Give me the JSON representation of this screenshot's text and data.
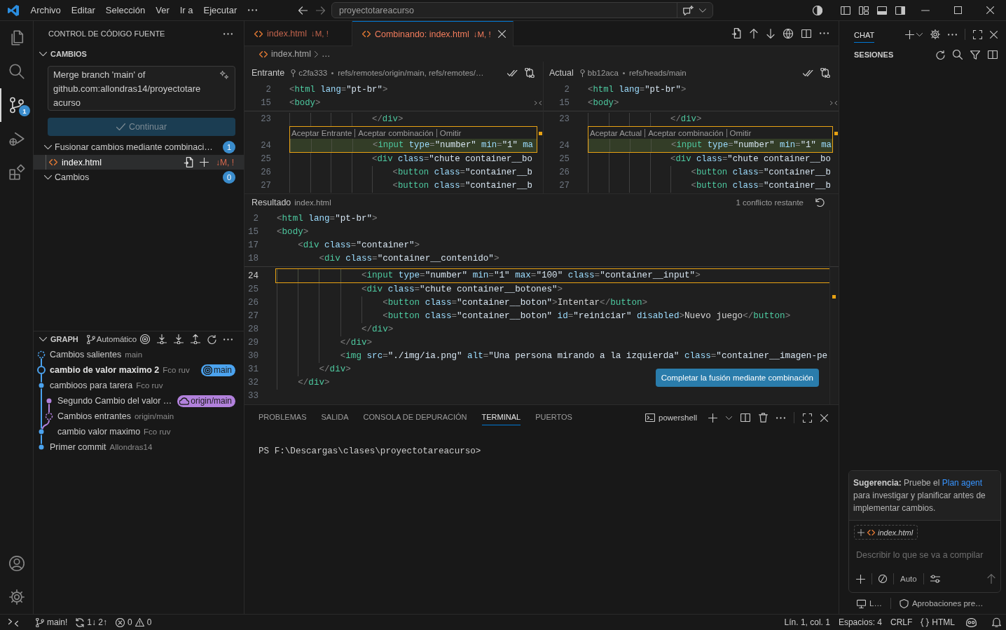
{
  "title_bar": {
    "menu": [
      "Archivo",
      "Editar",
      "Selección",
      "Ver",
      "Ir a",
      "Ejecutar"
    ],
    "command_center": {
      "label": "proyectotareacurso"
    }
  },
  "activity_bar": {
    "items": [
      {
        "selected": false
      },
      {
        "selected": false
      },
      {
        "selected": true,
        "badge": "1"
      },
      {
        "selected": false
      },
      {
        "selected": false
      }
    ]
  },
  "sidebar": {
    "title": "CONTROL DE CÓDIGO FUENTE",
    "changes": {
      "title": "CAMBIOS",
      "expanded": true,
      "commit_message": {
        "value": "Merge branch 'main' of github.com:allondras14/proyectotareacurso"
      },
      "continue_button": {
        "label": "Continuar",
        "disabled": true
      },
      "groups": [
        {
          "label": "Fusionar cambios mediante combinaci…",
          "count": "1",
          "expanded": true,
          "files": [
            {
              "name": "index.html",
              "status": "↓M, !",
              "selected": true
            }
          ]
        },
        {
          "label": "Cambios",
          "count": "0",
          "expanded": true
        }
      ]
    },
    "graph": {
      "title": "GRAPH",
      "expanded": true,
      "mode": "Automático",
      "commits": [
        {
          "kind": "outgoing",
          "message": "Cambios salientes",
          "description": "main",
          "color": "#4ba3ef"
        },
        {
          "kind": "head",
          "message": "cambio de valor maximo 2",
          "description": "Fco ruv",
          "color": "#4ba3ef",
          "ref": {
            "kind": "local",
            "label": "main"
          }
        },
        {
          "kind": "commit",
          "message": "cambioos para tarera",
          "description": "Fco ruv",
          "color": "#4ba3ef"
        },
        {
          "kind": "commit",
          "message": "Segundo Cambio del valor …",
          "color": "#b281dc",
          "ref": {
            "kind": "remote",
            "label": "origin/main"
          }
        },
        {
          "kind": "incoming",
          "message": "Cambios entrantes",
          "description": "origin/main",
          "color": "#b281dc"
        },
        {
          "kind": "commit",
          "message": "cambio valor maximo",
          "description": "Fco ruv",
          "color": "#4ba3ef"
        },
        {
          "kind": "commit",
          "message": "Primer commit",
          "description": "Allondras14",
          "color": "#4ba3ef"
        }
      ]
    }
  },
  "editor": {
    "tabs": [
      {
        "label": "index.html",
        "status": "↓M, !",
        "selected": false
      },
      {
        "label": "Combinando: index.html",
        "status": "↓M, !",
        "selected": true
      }
    ],
    "breadcrumbs": [
      "index.html",
      "…"
    ],
    "incoming": {
      "title": "Entrante",
      "commit": "c2fa333",
      "refs": "refs/remotes/origin/main, refs/remotes/…",
      "actions": [
        "Aceptar Entrante",
        "Aceptar combinación",
        "Omitir"
      ],
      "lines": [
        {
          "number": "2",
          "text": "<html lang=\"pt-br\">",
          "kind": "sticky"
        },
        {
          "number": "15",
          "text": "<body>",
          "kind": "sticky"
        },
        {
          "number": "23",
          "text": "                </div>",
          "kind": "code"
        },
        {
          "number": "24",
          "text": "                <input type=\"number\" min=\"1\" ma",
          "kind": "conflict"
        },
        {
          "number": "25",
          "text": "                <div class=\"chute container__bo",
          "kind": "code"
        },
        {
          "number": "26",
          "text": "                    <button class=\"container__b",
          "kind": "code"
        },
        {
          "number": "27",
          "text": "                    <button class=\"container__b",
          "kind": "code"
        }
      ]
    },
    "current": {
      "title": "Actual",
      "commit": "bb12aca",
      "refs": "refs/heads/main",
      "actions": [
        "Aceptar Actual",
        "Aceptar combinación",
        "Omitir"
      ],
      "lines": [
        {
          "number": "2",
          "text": "<html lang=\"pt-br\">",
          "kind": "sticky"
        },
        {
          "number": "15",
          "text": "<body>",
          "kind": "sticky"
        },
        {
          "number": "23",
          "text": "                </div>",
          "kind": "code"
        },
        {
          "number": "24",
          "text": "                <input type=\"number\" min=\"1\" ma",
          "kind": "conflict"
        },
        {
          "number": "25",
          "text": "                <div class=\"chute container__bo",
          "kind": "code"
        },
        {
          "number": "26",
          "text": "                    <button class=\"container__b",
          "kind": "code"
        },
        {
          "number": "27",
          "text": "                    <button class=\"container__b",
          "kind": "code"
        }
      ]
    },
    "result": {
      "title": "Resultado",
      "file": "index.html",
      "status": "1 conflicto restante",
      "lines": [
        {
          "number": "2",
          "text": "<html lang=\"pt-br\">",
          "kind": "sticky"
        },
        {
          "number": "15",
          "text": "<body>",
          "kind": "sticky"
        },
        {
          "number": "17",
          "text": "    <div class=\"container\">",
          "kind": "sticky"
        },
        {
          "number": "18",
          "text": "        <div class=\"container__contenido\">",
          "kind": "sticky"
        },
        {
          "number": "24",
          "text": "                <input type=\"number\" min=\"1\" max=\"100\" class=\"container__input\">",
          "kind": "conflict"
        },
        {
          "number": "25",
          "text": "                <div class=\"chute container__botones\">",
          "kind": "code"
        },
        {
          "number": "26",
          "text": "                    <button class=\"container__boton\">Intentar</button>",
          "kind": "code"
        },
        {
          "number": "27",
          "text": "                    <button class=\"container__boton\" id=\"reiniciar\" disabled>Nuevo juego</button>",
          "kind": "code"
        },
        {
          "number": "28",
          "text": "                </div>",
          "kind": "code"
        },
        {
          "number": "29",
          "text": "            </div>",
          "kind": "code"
        },
        {
          "number": "30",
          "text": "            <img src=\"./img/ia.png\" alt=\"Una persona mirando a la izquierda\" class=\"container__imagen-pe",
          "kind": "code"
        },
        {
          "number": "31",
          "text": "        </div>",
          "kind": "code"
        },
        {
          "number": "32",
          "text": "    </div>",
          "kind": "code"
        },
        {
          "number": "33",
          "kind": "code"
        }
      ],
      "complete_button": {
        "label": "Completar la fusión mediante combinación"
      }
    }
  },
  "panel": {
    "tabs": [
      {
        "label": "PROBLEMAS",
        "selected": false
      },
      {
        "label": "SALIDA",
        "selected": false
      },
      {
        "label": "CONSOLA DE DEPURACIÓN",
        "selected": false
      },
      {
        "label": "TERMINAL",
        "selected": true
      },
      {
        "label": "PUERTOS",
        "selected": false
      }
    ],
    "terminal": {
      "profile": "powershell",
      "lines": [
        "PS F:\\Descargas\\clases\\proyectotareacurso>"
      ]
    }
  },
  "chat": {
    "tabs": [
      {
        "label": "CHAT",
        "selected": true
      }
    ],
    "sessions_title": "SESIONES",
    "suggestion": {
      "lead": "**Sugerencia:** Pruebe el",
      "link": "Plan agent",
      "rest": "para investigar y planificar antes de implementar cambios."
    },
    "attachments": [
      {
        "name": "index.html"
      }
    ],
    "input": {
      "placeholder": "Describir lo que se va a compilar"
    },
    "mode": "Auto",
    "footer": [
      {
        "label": "L…"
      },
      {
        "label": "Aprobaciones pre…"
      }
    ]
  },
  "status_bar": {
    "branch": "main!",
    "sync": "1↓ 2↑",
    "errors": "0",
    "warnings": "0",
    "position": "Lín. 1, col. 1",
    "indentation": "Espacios: 4",
    "eol": "CRLF",
    "language": "HTML"
  }
}
